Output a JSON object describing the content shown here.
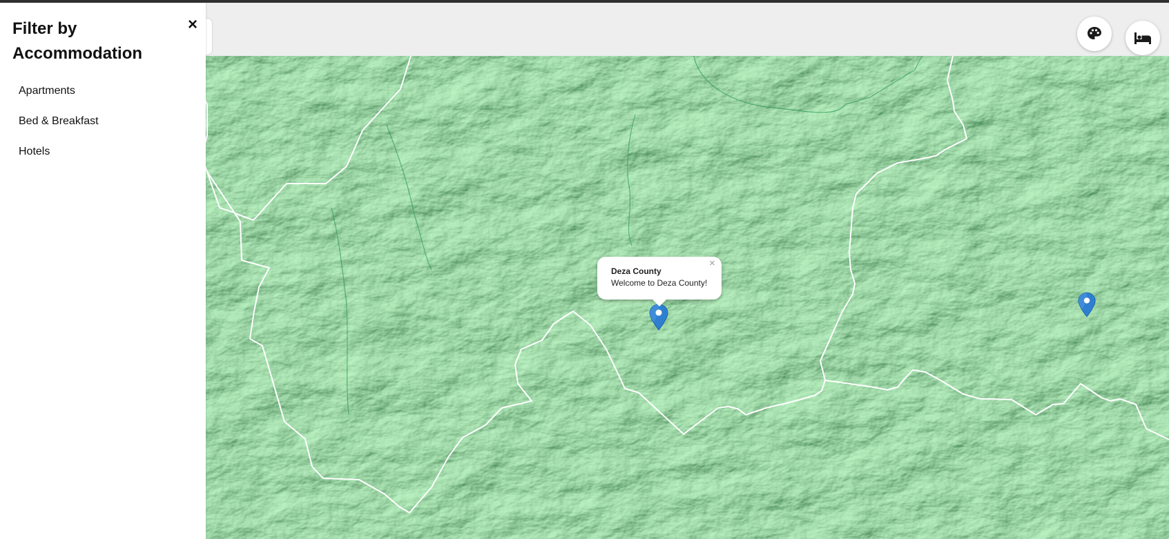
{
  "sidebar": {
    "title": "Filter by Accommodation",
    "close_label": "×",
    "items": [
      {
        "label": "Apartments"
      },
      {
        "label": "Bed & Breakfast"
      },
      {
        "label": "Hotels"
      }
    ]
  },
  "header": {
    "buttons": [
      {
        "icon": "palette-icon"
      },
      {
        "icon": "bed-icon"
      }
    ]
  },
  "map": {
    "base_color": "#2e9a45",
    "border_color": "#ffffff",
    "markers": [
      {
        "name": "Deza County marker",
        "color": "#2f7fd0"
      },
      {
        "name": "second marker",
        "color": "#2f7fd0"
      }
    ],
    "popup": {
      "title": "Deza County",
      "text": "Welcome to Deza County!",
      "close_label": "×"
    }
  }
}
